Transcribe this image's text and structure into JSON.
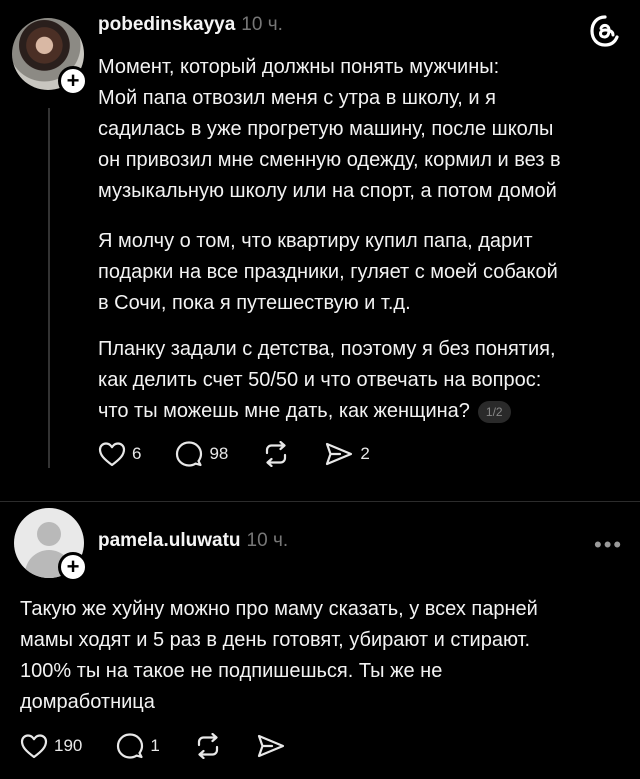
{
  "post": {
    "username": "pobedinskayya",
    "time": "10 ч.",
    "paragraphs": [
      [
        "Момент, который должны понять мужчины:",
        "Мой папа отвозил меня с утра в школу, и я",
        "садилась в уже прогретую машину, после школы",
        "он привозил мне сменную одежду, кормил и вез в",
        "музыкальную школу или на спорт, а потом домой"
      ],
      [
        "Я молчу о том, что квартиру купил папа, дарит",
        "подарки на все праздники, гуляет с моей собакой",
        "в Сочи, пока я путешествую и т.д."
      ],
      [
        "Планку задали с детства, поэтому я без понятия,",
        "как делить счет 50/50 и что отвечать на вопрос:",
        "что ты можешь мне дать, как женщина?"
      ]
    ],
    "pager": "1/2",
    "likes": "6",
    "replies": "98",
    "shares": "2"
  },
  "reply": {
    "username": "pamela.uluwatu",
    "time": "10 ч.",
    "lines": [
      "Такую же хуйну можно про маму сказать, у всех парней",
      "мамы ходят и 5 раз в день готовят, убирают и стирают.",
      "100% ты на такое не подпишешься. Ты же не",
      "домработница"
    ],
    "likes": "190",
    "replies": "1"
  },
  "icons": {
    "plus": "+",
    "more": "•••",
    "app_logo": "threads-logo"
  }
}
